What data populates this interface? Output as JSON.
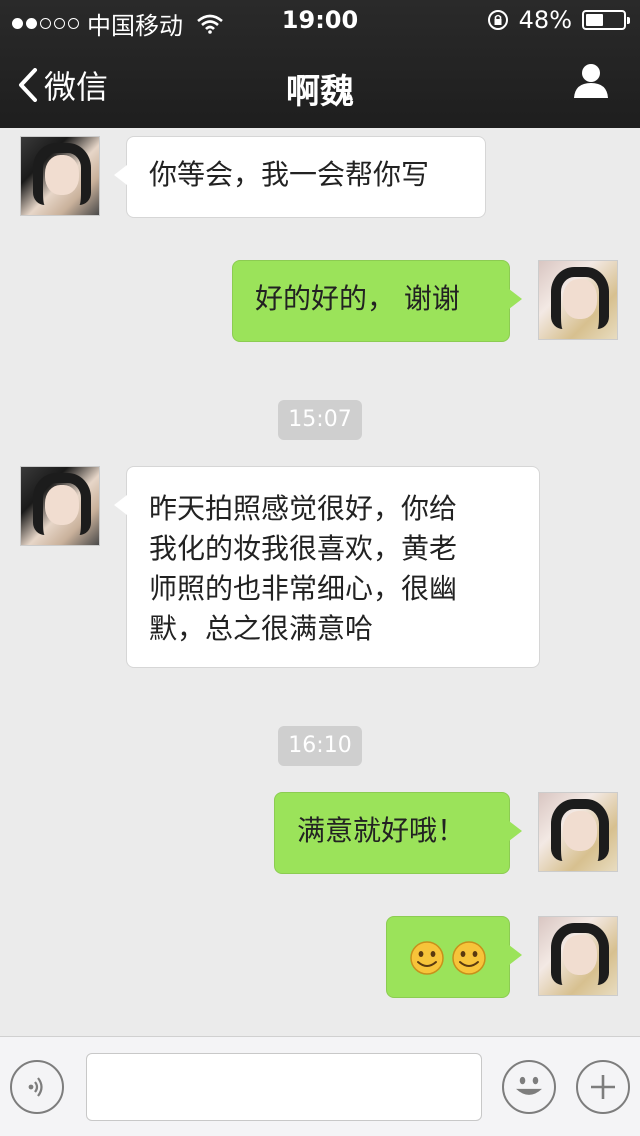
{
  "status_bar": {
    "carrier": "中国移动",
    "time": "19:00",
    "battery": "48%",
    "battery_level": 0.48
  },
  "nav": {
    "back_label": "微信",
    "title": "啊魏"
  },
  "messages": [
    {
      "side": "in",
      "text": "你等会，我一会帮你写"
    },
    {
      "side": "out",
      "text": "好的好的， 谢谢"
    },
    {
      "type": "timestamp",
      "text": "15:07"
    },
    {
      "side": "in",
      "lines": [
        "昨天拍照感觉很好，你给",
        "我化的妆我很喜欢，黄老",
        "师照的也非常细心，很幽",
        "默，总之很满意哈"
      ]
    },
    {
      "type": "timestamp",
      "text": "16:10"
    },
    {
      "side": "out",
      "text": "满意就好哦！"
    },
    {
      "side": "out",
      "emoji": [
        "smile-emoji",
        "smile-emoji"
      ]
    }
  ],
  "input_bar": {
    "voice_icon": "voice-icon",
    "emoji_icon": "smiley-icon",
    "add_icon": "plus-icon",
    "value": ""
  }
}
